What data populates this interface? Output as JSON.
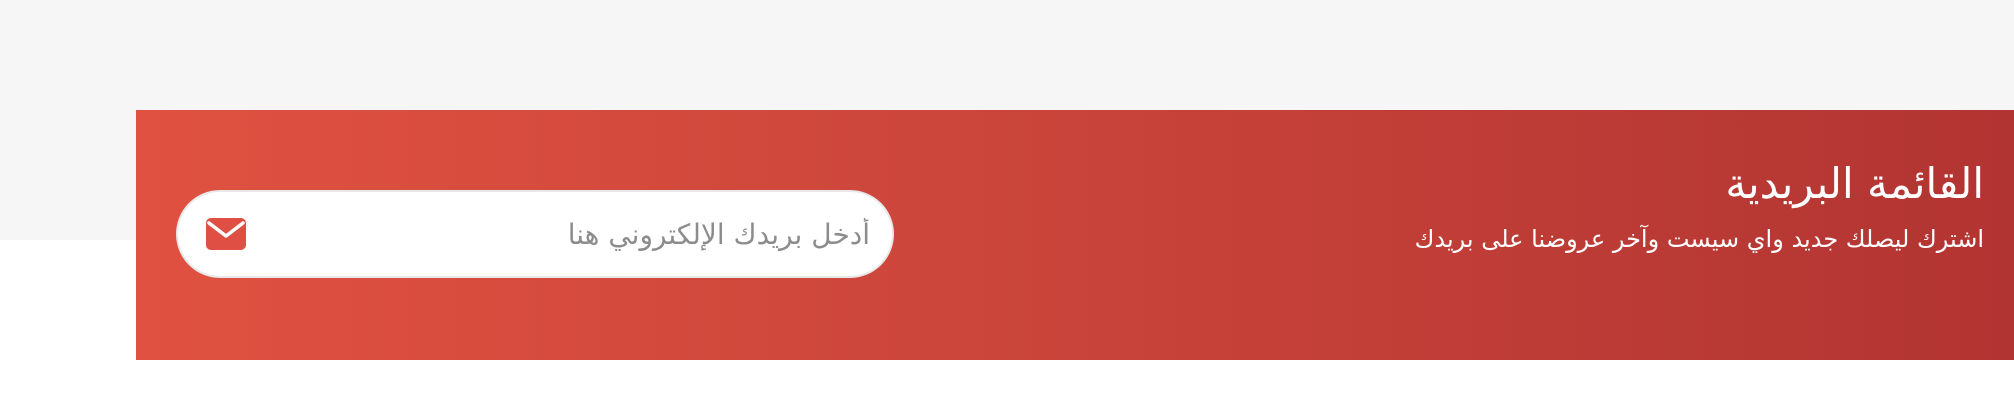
{
  "newsletter": {
    "title": "القائمة البريدية",
    "subtitle": "اشترك ليصلك جديد واي سيست وآخر عروضنا على بريدك",
    "email_placeholder": "أدخل بريدك الإلكتروني هنا",
    "submit_icon": "envelope-icon",
    "colors": {
      "gradient_start": "#e05141",
      "gradient_end": "#b23432",
      "icon": "#df4f43",
      "page_background": "#f6f6f6"
    }
  }
}
